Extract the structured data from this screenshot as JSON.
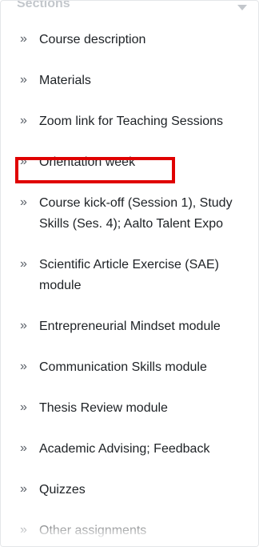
{
  "sections": {
    "title": "Sections",
    "colors": {
      "highlight": "#e00000",
      "text": "#1d2125",
      "muted": "#c3c7cc"
    },
    "chevron": "»",
    "items": [
      {
        "label": "Course description"
      },
      {
        "label": "Materials"
      },
      {
        "label": "Zoom link for Teaching Sessions"
      },
      {
        "label": "Orientation week",
        "highlighted": true
      },
      {
        "label": "Course kick-off (Session 1), Study Skills (Ses. 4); Aalto Talent Expo"
      },
      {
        "label": "Scientific Article Exercise (SAE) module"
      },
      {
        "label": "Entrepreneurial Mindset module"
      },
      {
        "label": "Communication Skills module"
      },
      {
        "label": "Thesis Review module"
      },
      {
        "label": "Academic Advising; Feedback"
      },
      {
        "label": "Quizzes"
      },
      {
        "label": "Other assignments"
      }
    ]
  }
}
